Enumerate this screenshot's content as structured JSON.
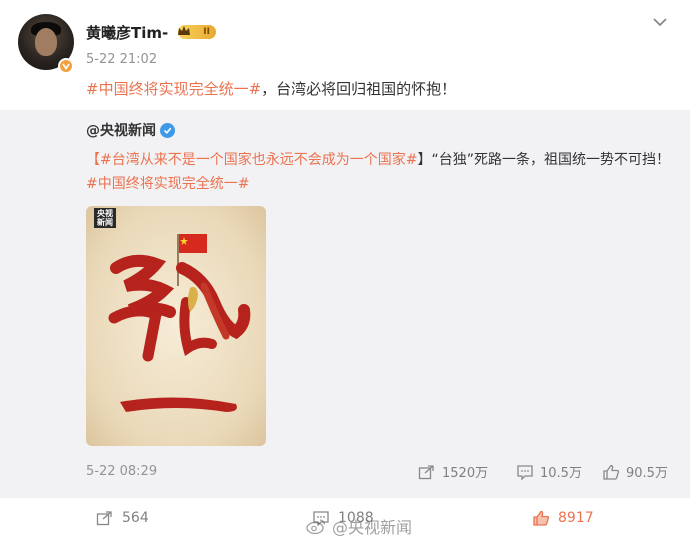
{
  "post": {
    "username": "黄曦彦Tim-",
    "level": "II",
    "time": "5-22 21:02",
    "topic": "#中国终将实现完全统一#",
    "text": "，台湾必将回归祖国的怀抱！"
  },
  "repost": {
    "username": "@央视新闻",
    "bracket_open": "【",
    "topic1": "#台湾从来不是一个国家也永远不会成为一个国家#",
    "bracket_close": "】",
    "text1": "“台独”死路一条，祖国统一势不可挡！",
    "topic2": "#中国终将实现完全统一#",
    "image_logo": "央视新闻",
    "time": "5-22 08:29",
    "shares": "1520万",
    "comments": "10.5万",
    "likes": "90.5万"
  },
  "footer": {
    "shares": "564",
    "comments": "1088",
    "likes": "8917"
  },
  "watermark": "@央视新闻",
  "colors": {
    "accent": "#eb7350",
    "verified_blue": "#3e99e8",
    "repost_bg": "#f2f2f5",
    "muted": "#939393"
  }
}
